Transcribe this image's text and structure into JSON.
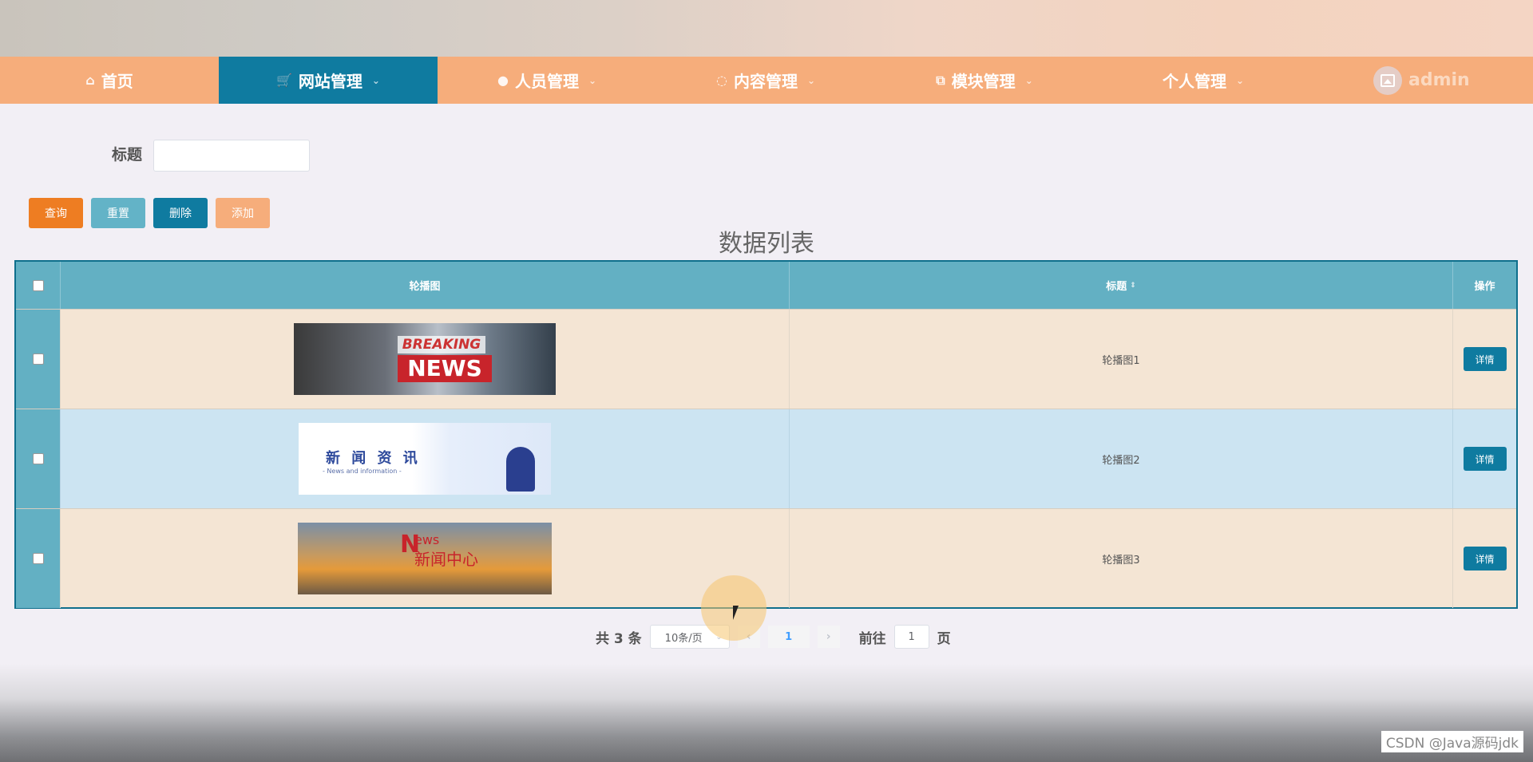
{
  "nav": {
    "items": [
      {
        "label": "首页",
        "icon": "home-icon",
        "active": false,
        "has_dropdown": false
      },
      {
        "label": "网站管理",
        "icon": "cart-icon",
        "active": true,
        "has_dropdown": true
      },
      {
        "label": "人员管理",
        "icon": "user-icon",
        "active": false,
        "has_dropdown": true
      },
      {
        "label": "内容管理",
        "icon": "chat-icon",
        "active": false,
        "has_dropdown": true
      },
      {
        "label": "模块管理",
        "icon": "copy-icon",
        "active": false,
        "has_dropdown": true
      },
      {
        "label": "个人管理",
        "icon": "",
        "active": false,
        "has_dropdown": true
      }
    ],
    "username": "admin"
  },
  "search": {
    "label": "标题",
    "value": ""
  },
  "buttons": {
    "query": "查询",
    "reset": "重置",
    "delete": "删除",
    "add": "添加"
  },
  "list_title": "数据列表",
  "table": {
    "headers": {
      "image": "轮播图",
      "title": "标题",
      "op": "操作"
    },
    "rows": [
      {
        "title": "轮播图1",
        "detail": "详情",
        "image": {
          "line1": "BREAKING",
          "line2": "NEWS"
        }
      },
      {
        "title": "轮播图2",
        "detail": "详情",
        "image": {
          "line1": "新 闻 资 讯",
          "line2": "- News and information -"
        }
      },
      {
        "title": "轮播图3",
        "detail": "详情",
        "image": {
          "line1": "N",
          "line2": "ews",
          "line3": "新闻中心"
        }
      }
    ]
  },
  "pager": {
    "total": "共 3 条",
    "page_size": "10条/页",
    "current": "1",
    "goto": "前往",
    "goto_value": "1",
    "page_suffix": "页"
  },
  "watermark": "CSDN @Java源码jdk",
  "colors": {
    "nav": "#f6ad7b",
    "active": "#0f7ba0",
    "header": "#63b0c3",
    "query": "#ee7d22"
  }
}
